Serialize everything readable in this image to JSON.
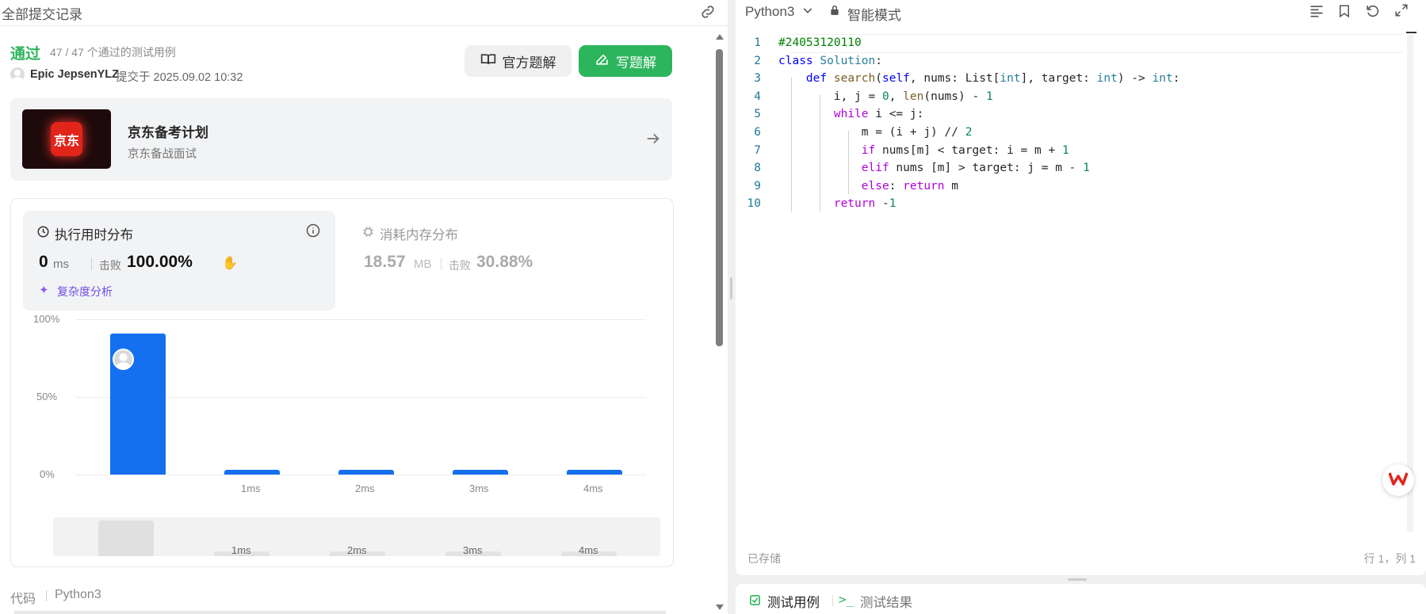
{
  "left": {
    "header_title": "全部提交记录",
    "status": "通过",
    "tests_passed": "47 / 47 个通过的测试用例",
    "author": "Epic JepsenYLZ",
    "submitted_at": "提交于 2025.09.02 10:32",
    "btn_official": "官方题解",
    "btn_write": "写题解",
    "promo": {
      "logo": "京东",
      "title": "京东备考计划",
      "subtitle": "京东备战面试"
    },
    "runtime": {
      "title": "执行用时分布",
      "value": "0",
      "unit": "ms",
      "beats_label": "击败",
      "beats": "100.00%",
      "complexity": "复杂度分析"
    },
    "memory": {
      "title": "消耗内存分布",
      "value": "18.57",
      "unit": "MB",
      "beats_label": "击败",
      "beats": "30.88%"
    },
    "code_label": "代码",
    "code_lang": "Python3"
  },
  "chart_data": {
    "type": "bar",
    "categories": [
      "",
      "1ms",
      "2ms",
      "3ms",
      "4ms"
    ],
    "values": [
      91,
      3,
      3,
      3,
      3
    ],
    "y_ticks": [
      "100%",
      "50%",
      "0%"
    ],
    "ylim": [
      0,
      100
    ],
    "grid": true
  },
  "minimap_labels": [
    "1ms",
    "2ms",
    "3ms",
    "4ms"
  ],
  "editor": {
    "language": "Python3",
    "mode": "智能模式",
    "saved": "已存储",
    "cursor": "行 1，列 1",
    "code": [
      "#24053120110",
      "class Solution:",
      "    def search(self, nums: List[int], target: int) -> int:",
      "        i, j = 0, len(nums) - 1",
      "        while i <= j:",
      "            m = (i + j) // 2",
      "            if nums[m] < target: i = m + 1",
      "            elif nums [m] > target: j = m - 1",
      "            else: return m",
      "        return -1"
    ]
  },
  "bottom_tabs": {
    "tests": "测试用例",
    "results": "测试结果"
  },
  "colors": {
    "accent_green": "#2db55d",
    "accent_blue": "#1570ef",
    "promo_red": "#e1251b"
  }
}
